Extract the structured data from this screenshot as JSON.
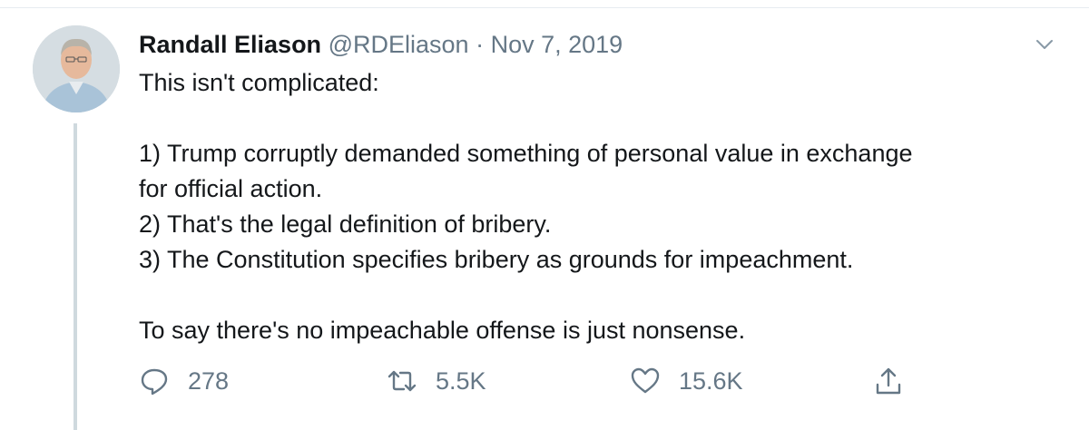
{
  "tweet": {
    "display_name": "Randall Eliason",
    "handle": "@RDEliason",
    "separator": "·",
    "date": "Nov 7, 2019",
    "lines": [
      "This isn't complicated:",
      "",
      "1) Trump corruptly demanded something of personal value in exchange",
      "for official action.",
      "2) That's the legal definition of bribery.",
      "3) The Constitution specifies bribery as grounds for impeachment.",
      "",
      "To say there's no impeachable offense is just nonsense."
    ]
  },
  "actions": {
    "replies": "278",
    "retweets": "5.5K",
    "likes": "15.6K"
  },
  "icons": [
    "chevron-down-icon",
    "reply-icon",
    "retweet-icon",
    "like-icon",
    "share-icon"
  ],
  "colors": {
    "text": "#14171a",
    "secondary": "#657786",
    "thread": "#cfd9de"
  }
}
